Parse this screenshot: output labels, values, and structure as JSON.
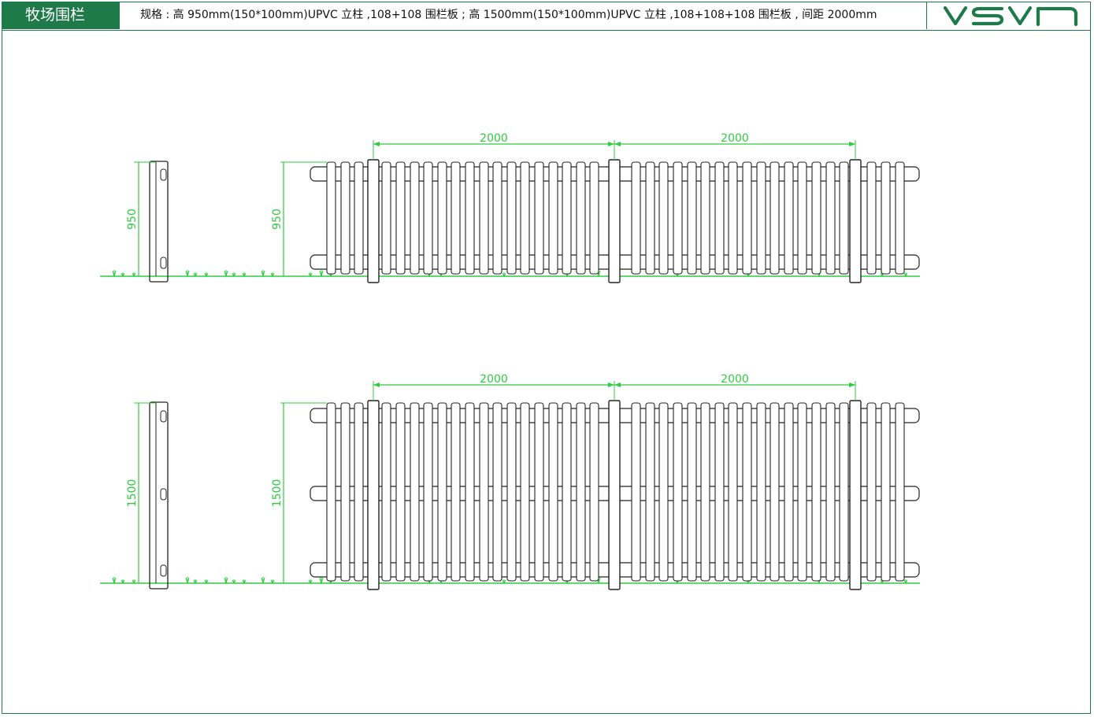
{
  "header": {
    "title": "牧场围栏",
    "spec": "规格 : 高 950mm(150*100mm)UPVC 立柱 ,108+108 围栏板 ; 高 1500mm(150*100mm)UPVC 立柱 ,108+108+108 围栏板 , 间距 2000mm",
    "logo_text": "VSVN"
  },
  "colors": {
    "brand": "#1f7a4a",
    "dimension": "#2ecc40",
    "line": "#222222"
  },
  "drawings": [
    {
      "height_label": "950",
      "span_labels": [
        "2000",
        "2000"
      ],
      "rails": 2
    },
    {
      "height_label": "1500",
      "span_labels": [
        "2000",
        "2000"
      ],
      "rails": 3
    }
  ]
}
